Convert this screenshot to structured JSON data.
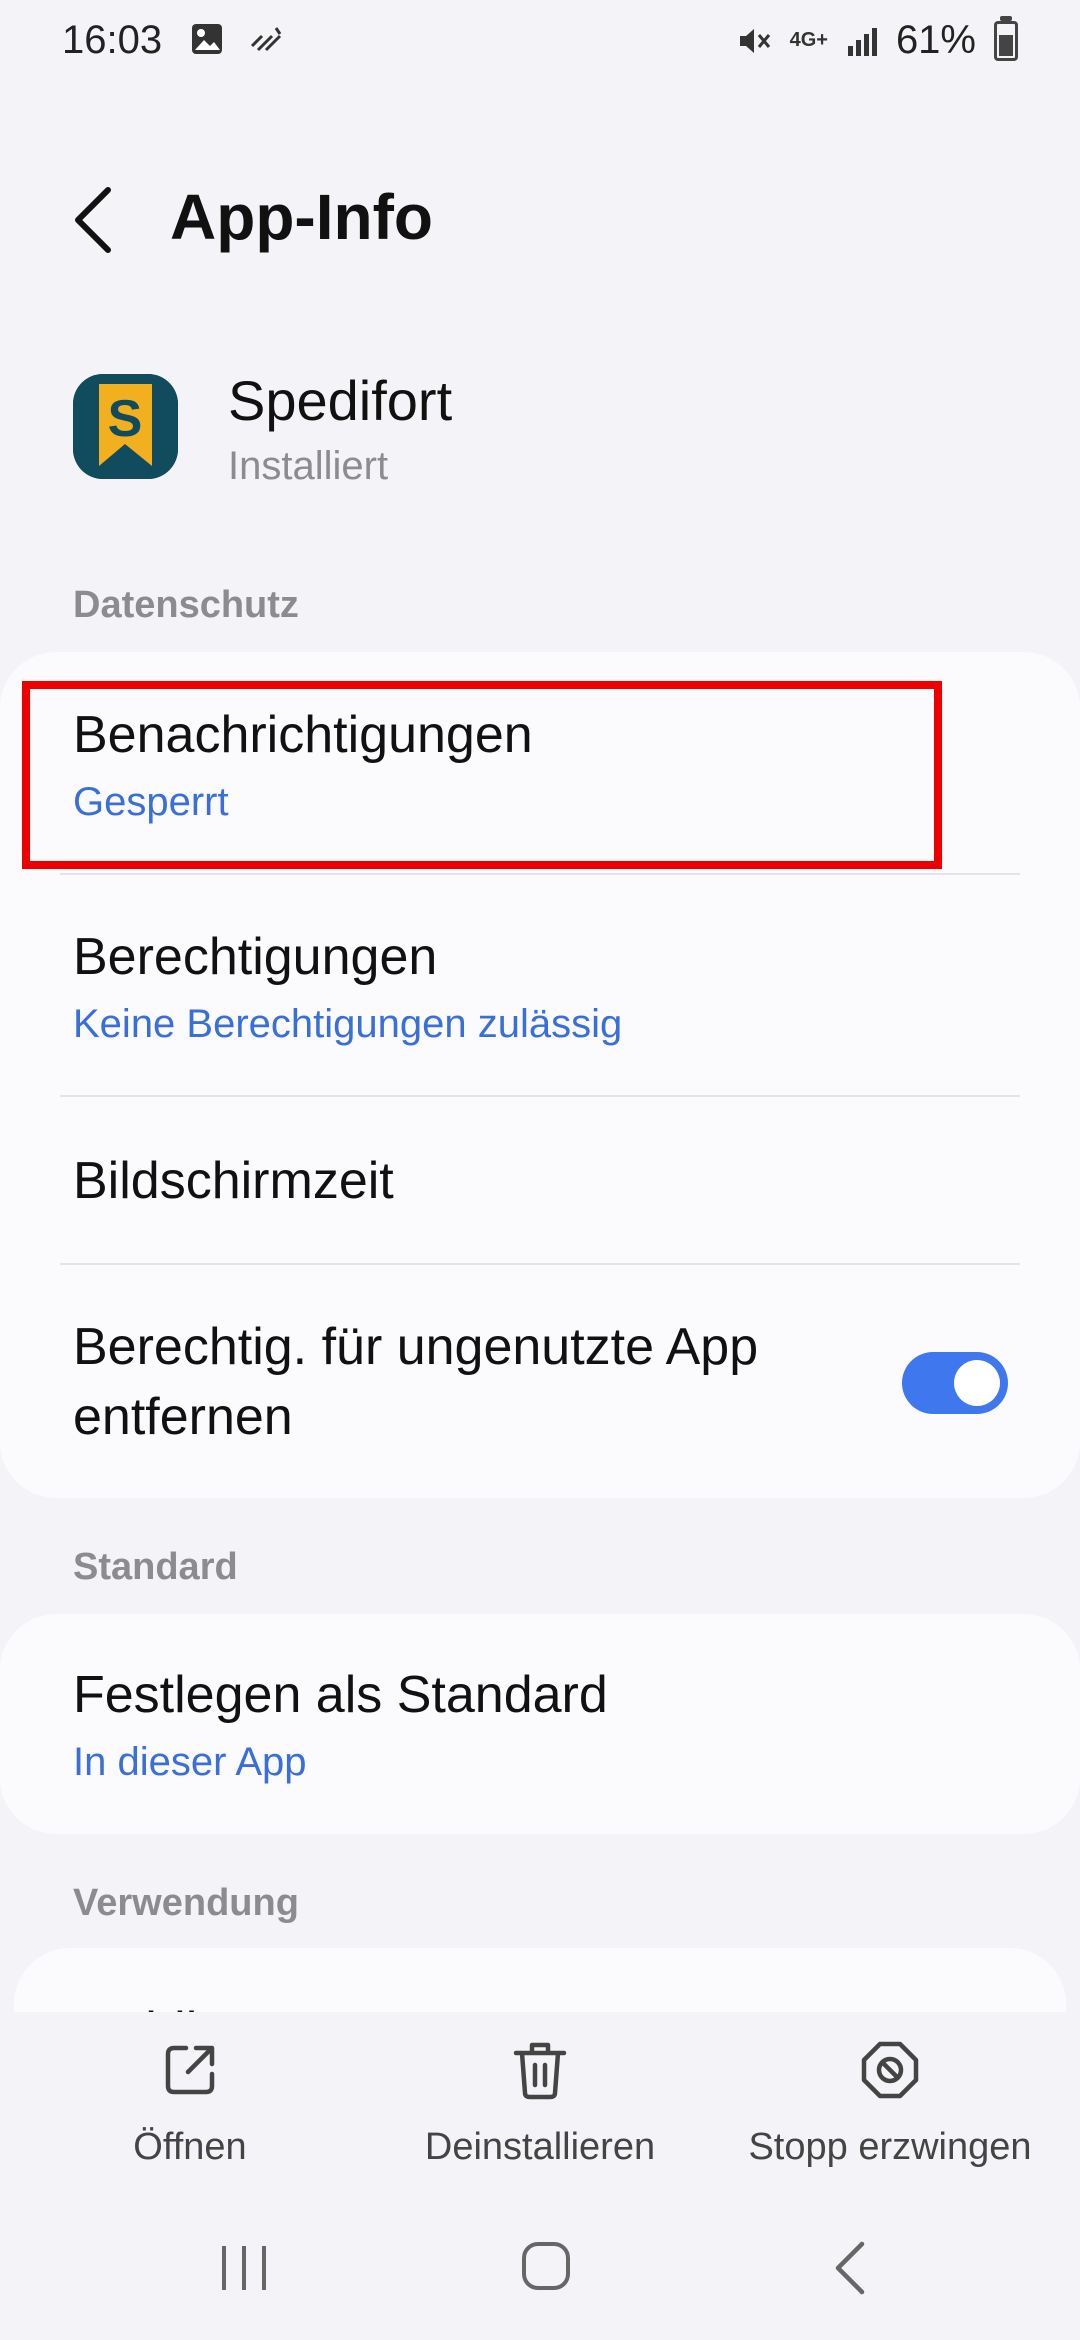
{
  "status_bar": {
    "time": "16:03",
    "network": "4G+",
    "battery": "61%",
    "battery_level": 0.61
  },
  "header": {
    "title": "App-Info",
    "back_icon": "back-chevron-icon"
  },
  "app": {
    "name": "Spedifort",
    "status": "Installiert",
    "icon_letter": "S",
    "icon_colors": {
      "background": "#104b5e",
      "accent": "#f2b01e"
    }
  },
  "sections": {
    "privacy": {
      "label": "Datenschutz",
      "items": [
        {
          "title": "Benachrichtigungen",
          "subtitle": "Gesperrt"
        },
        {
          "title": "Berechtigungen",
          "subtitle": "Keine Berechtigungen zulässig"
        },
        {
          "title": "Bildschirmzeit"
        },
        {
          "title": "Berechtig. für ungenutzte App entfernen",
          "toggle_on": true
        }
      ]
    },
    "standard": {
      "label": "Standard",
      "items": [
        {
          "title": "Festlegen als Standard",
          "subtitle": "In dieser App"
        }
      ]
    },
    "usage": {
      "label": "Verwendung",
      "items": [
        {
          "title": "Mobile Daten"
        }
      ]
    }
  },
  "actions": [
    {
      "label": "Öffnen",
      "icon": "open-external-icon"
    },
    {
      "label": "Deinstallieren",
      "icon": "trash-icon"
    },
    {
      "label": "Stopp erzwingen",
      "icon": "force-stop-icon"
    }
  ],
  "colors": {
    "accent": "#3e77ee",
    "link": "#3a6fd8",
    "highlight": "#ee0000"
  }
}
